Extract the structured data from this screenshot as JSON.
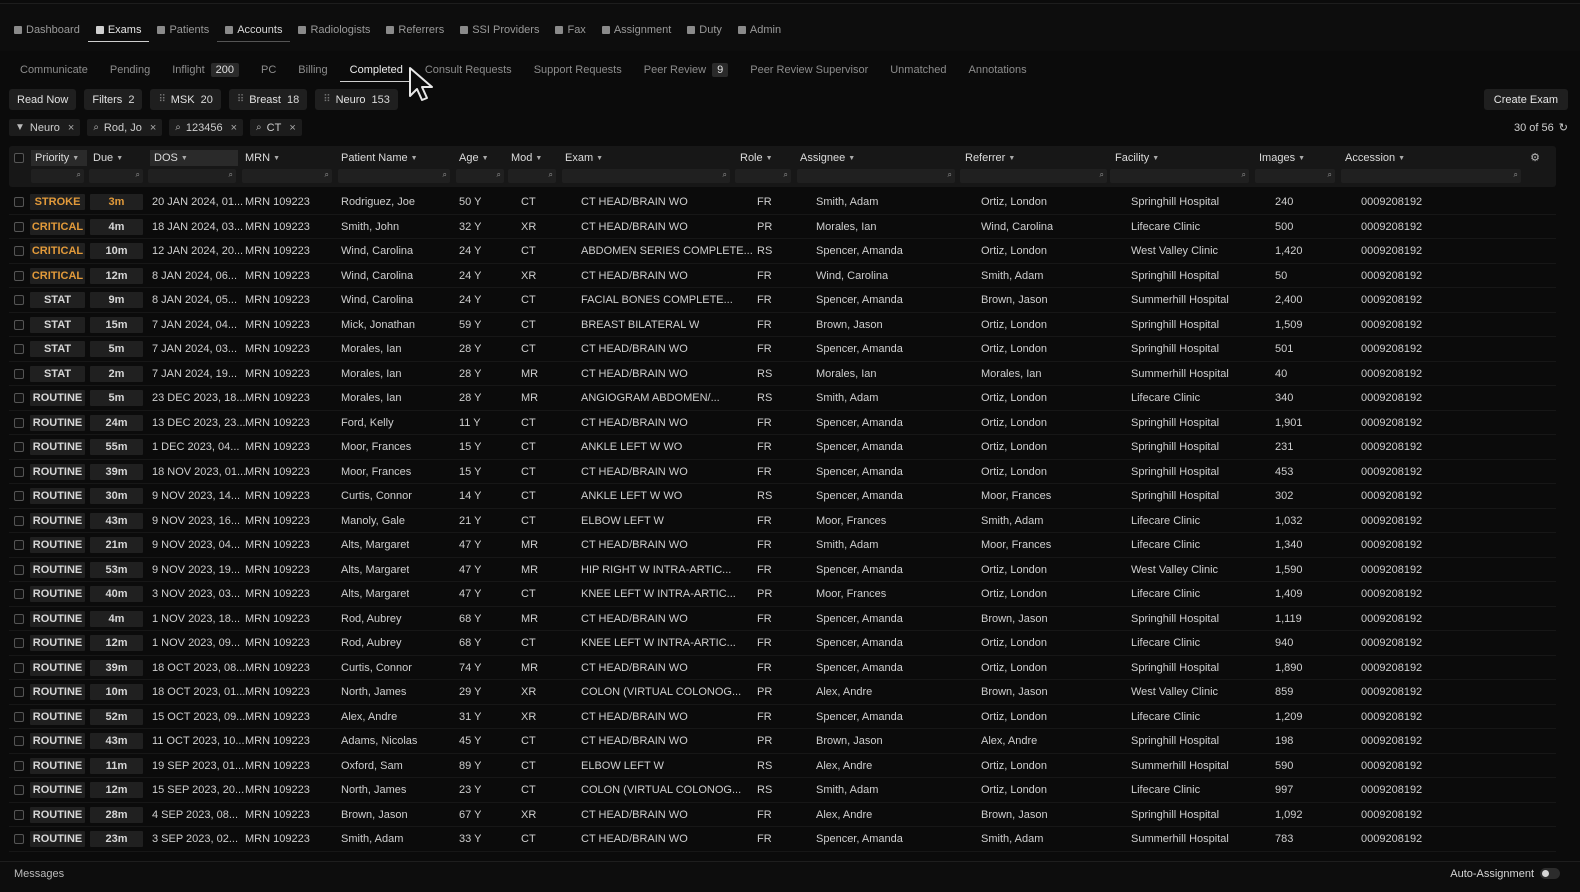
{
  "topnav": [
    {
      "label": "Dashboard",
      "icon": "grid-icon",
      "state": ""
    },
    {
      "label": "Exams",
      "icon": "doc-icon",
      "state": "active"
    },
    {
      "label": "Patients",
      "icon": "people-icon",
      "state": ""
    },
    {
      "label": "Accounts",
      "icon": "building-icon",
      "state": "hl"
    },
    {
      "label": "Radiologists",
      "icon": "person-icon",
      "state": ""
    },
    {
      "label": "Referrers",
      "icon": "card-icon",
      "state": ""
    },
    {
      "label": "SSI Providers",
      "icon": "people-icon",
      "state": ""
    },
    {
      "label": "Fax",
      "icon": "fax-icon",
      "state": ""
    },
    {
      "label": "Assignment",
      "icon": "check-icon",
      "state": ""
    },
    {
      "label": "Duty",
      "icon": "briefcase-icon",
      "state": ""
    },
    {
      "label": "Admin",
      "icon": "shield-icon",
      "state": ""
    }
  ],
  "subnav": [
    {
      "label": "Communicate",
      "count": ""
    },
    {
      "label": "Pending",
      "count": ""
    },
    {
      "label": "Inflight",
      "count": "200"
    },
    {
      "label": "PC",
      "count": ""
    },
    {
      "label": "Billing",
      "count": ""
    },
    {
      "label": "Completed",
      "count": "",
      "active": true
    },
    {
      "label": "Consult Requests",
      "count": ""
    },
    {
      "label": "Support Requests",
      "count": ""
    },
    {
      "label": "Peer Review",
      "count": "9"
    },
    {
      "label": "Peer Review Supervisor",
      "count": ""
    },
    {
      "label": "Unmatched",
      "count": ""
    },
    {
      "label": "Annotations",
      "count": ""
    }
  ],
  "toolbar": {
    "read_now": "Read Now",
    "filters_label": "Filters",
    "filters_count": "2",
    "groups": [
      {
        "label": "MSK",
        "count": "20"
      },
      {
        "label": "Breast",
        "count": "18"
      },
      {
        "label": "Neuro",
        "count": "153"
      }
    ],
    "create_exam": "Create Exam"
  },
  "active_filters": [
    {
      "label": "Neuro",
      "icon": "filter-icon"
    },
    {
      "label": "Rod, Jo",
      "icon": "search-icon"
    },
    {
      "label": "123456",
      "icon": "search-icon"
    },
    {
      "label": "CT",
      "icon": "search-icon"
    }
  ],
  "result_count": "30 of 56",
  "columns": [
    "Priority",
    "Due",
    "DOS",
    "MRN",
    "Patient Name",
    "Age",
    "Mod",
    "Exam",
    "Role",
    "Assignee",
    "Referrer",
    "Facility",
    "Images",
    "Accession"
  ],
  "rows": [
    [
      "STROKE",
      "3m",
      "20 JAN 2024, 01...",
      "MRN 109223",
      "Rodriguez, Joe",
      "50 Y",
      "CT",
      "CT HEAD/BRAIN WO",
      "FR",
      "Smith, Adam",
      "Ortiz, London",
      "Springhill Hospital",
      "240",
      "0009208192"
    ],
    [
      "CRITICAL",
      "4m",
      "18 JAN 2024, 03...",
      "MRN 109223",
      "Smith, John",
      "32 Y",
      "XR",
      "CT HEAD/BRAIN WO",
      "PR",
      "Morales, Ian",
      "Wind, Carolina",
      "Lifecare Clinic",
      "500",
      "0009208192"
    ],
    [
      "CRITICAL",
      "10m",
      "12 JAN 2024, 20...",
      "MRN 109223",
      "Wind, Carolina",
      "24 Y",
      "CT",
      "ABDOMEN SERIES COMPLETE...",
      "RS",
      "Spencer, Amanda",
      "Ortiz, London",
      "West Valley Clinic",
      "1,420",
      "0009208192"
    ],
    [
      "CRITICAL",
      "12m",
      "8 JAN 2024, 06...",
      "MRN 109223",
      "Wind, Carolina",
      "24 Y",
      "XR",
      "CT HEAD/BRAIN WO",
      "FR",
      "Wind, Carolina",
      "Smith, Adam",
      "Springhill Hospital",
      "50",
      "0009208192"
    ],
    [
      "STAT",
      "9m",
      "8 JAN 2024, 05...",
      "MRN 109223",
      "Wind, Carolina",
      "24 Y",
      "CT",
      "FACIAL BONES COMPLETE...",
      "FR",
      "Spencer, Amanda",
      "Brown, Jason",
      "Summerhill Hospital",
      "2,400",
      "0009208192"
    ],
    [
      "STAT",
      "15m",
      "7 JAN 2024, 04...",
      "MRN 109223",
      "Mick, Jonathan",
      "59 Y",
      "CT",
      "BREAST BILATERAL W",
      "FR",
      "Brown, Jason",
      "Ortiz, London",
      "Springhill Hospital",
      "1,509",
      "0009208192"
    ],
    [
      "STAT",
      "5m",
      "7 JAN 2024, 03...",
      "MRN 109223",
      "Morales, Ian",
      "28 Y",
      "CT",
      "CT HEAD/BRAIN WO",
      "FR",
      "Spencer, Amanda",
      "Ortiz, London",
      "Springhill Hospital",
      "501",
      "0009208192"
    ],
    [
      "STAT",
      "2m",
      "7 JAN 2024, 19...",
      "MRN 109223",
      "Morales, Ian",
      "28 Y",
      "MR",
      "CT HEAD/BRAIN WO",
      "RS",
      "Morales, Ian",
      "Morales, Ian",
      "Summerhill Hospital",
      "40",
      "0009208192"
    ],
    [
      "ROUTINE",
      "5m",
      "23 DEC 2023, 18...",
      "MRN 109223",
      "Morales, Ian",
      "28 Y",
      "MR",
      "ANGIOGRAM ABDOMEN/...",
      "RS",
      "Smith, Adam",
      "Ortiz, London",
      "Lifecare Clinic",
      "340",
      "0009208192"
    ],
    [
      "ROUTINE",
      "24m",
      "13 DEC 2023, 23...",
      "MRN 109223",
      "Ford, Kelly",
      "11 Y",
      "CT",
      "CT HEAD/BRAIN WO",
      "FR",
      "Spencer, Amanda",
      "Ortiz, London",
      "Springhill Hospital",
      "1,901",
      "0009208192"
    ],
    [
      "ROUTINE",
      "55m",
      "1 DEC 2023, 04...",
      "MRN 109223",
      "Moor, Frances",
      "15 Y",
      "CT",
      "ANKLE LEFT W WO",
      "FR",
      "Spencer, Amanda",
      "Ortiz, London",
      "Springhill Hospital",
      "231",
      "0009208192"
    ],
    [
      "ROUTINE",
      "39m",
      "18 NOV 2023, 01...",
      "MRN 109223",
      "Moor, Frances",
      "15 Y",
      "CT",
      "CT HEAD/BRAIN WO",
      "FR",
      "Spencer, Amanda",
      "Ortiz, London",
      "Springhill Hospital",
      "453",
      "0009208192"
    ],
    [
      "ROUTINE",
      "30m",
      "9 NOV 2023, 14...",
      "MRN 109223",
      "Curtis, Connor",
      "14 Y",
      "CT",
      "ANKLE LEFT W WO",
      "RS",
      "Spencer, Amanda",
      "Moor, Frances",
      "Springhill Hospital",
      "302",
      "0009208192"
    ],
    [
      "ROUTINE",
      "43m",
      "9 NOV 2023, 16...",
      "MRN 109223",
      "Manoly, Gale",
      "21 Y",
      "CT",
      "ELBOW LEFT W",
      "FR",
      "Moor, Frances",
      "Smith, Adam",
      "Lifecare Clinic",
      "1,032",
      "0009208192"
    ],
    [
      "ROUTINE",
      "21m",
      "9 NOV 2023, 04...",
      "MRN 109223",
      "Alts, Margaret",
      "47 Y",
      "MR",
      "CT HEAD/BRAIN WO",
      "FR",
      "Smith, Adam",
      "Moor, Frances",
      "Lifecare Clinic",
      "1,340",
      "0009208192"
    ],
    [
      "ROUTINE",
      "53m",
      "9 NOV 2023, 19...",
      "MRN 109223",
      "Alts, Margaret",
      "47 Y",
      "MR",
      "HIP RIGHT W INTRA-ARTIC...",
      "FR",
      "Spencer, Amanda",
      "Ortiz, London",
      "West Valley Clinic",
      "1,590",
      "0009208192"
    ],
    [
      "ROUTINE",
      "40m",
      "3 NOV 2023, 03...",
      "MRN 109223",
      "Alts, Margaret",
      "47 Y",
      "CT",
      "KNEE LEFT W INTRA-ARTIC...",
      "PR",
      "Moor, Frances",
      "Ortiz, London",
      "Lifecare Clinic",
      "1,409",
      "0009208192"
    ],
    [
      "ROUTINE",
      "4m",
      "1 NOV 2023, 18...",
      "MRN 109223",
      "Rod, Aubrey",
      "68 Y",
      "MR",
      "CT HEAD/BRAIN WO",
      "FR",
      "Spencer, Amanda",
      "Brown, Jason",
      "Springhill Hospital",
      "1,119",
      "0009208192"
    ],
    [
      "ROUTINE",
      "12m",
      "1 NOV 2023, 09...",
      "MRN 109223",
      "Rod, Aubrey",
      "68 Y",
      "CT",
      "KNEE LEFT W INTRA-ARTIC...",
      "FR",
      "Spencer, Amanda",
      "Ortiz, London",
      "Lifecare Clinic",
      "940",
      "0009208192"
    ],
    [
      "ROUTINE",
      "39m",
      "18 OCT 2023, 08...",
      "MRN 109223",
      "Curtis, Connor",
      "74 Y",
      "MR",
      "CT HEAD/BRAIN WO",
      "FR",
      "Spencer, Amanda",
      "Ortiz, London",
      "Springhill Hospital",
      "1,890",
      "0009208192"
    ],
    [
      "ROUTINE",
      "10m",
      "18 OCT 2023, 01...",
      "MRN 109223",
      "North, James",
      "29 Y",
      "XR",
      "COLON (VIRTUAL COLONOG...",
      "PR",
      "Alex, Andre",
      "Brown, Jason",
      "West Valley Clinic",
      "859",
      "0009208192"
    ],
    [
      "ROUTINE",
      "52m",
      "15 OCT 2023, 09...",
      "MRN 109223",
      "Alex, Andre",
      "31 Y",
      "XR",
      "CT HEAD/BRAIN WO",
      "FR",
      "Spencer, Amanda",
      "Ortiz, London",
      "Lifecare Clinic",
      "1,209",
      "0009208192"
    ],
    [
      "ROUTINE",
      "43m",
      "11 OCT 2023, 10...",
      "MRN 109223",
      "Adams, Nicolas",
      "45 Y",
      "CT",
      "CT HEAD/BRAIN WO",
      "PR",
      "Brown, Jason",
      "Alex, Andre",
      "Springhill Hospital",
      "198",
      "0009208192"
    ],
    [
      "ROUTINE",
      "11m",
      "19 SEP 2023, 01...",
      "MRN 109223",
      "Oxford, Sam",
      "89 Y",
      "CT",
      "ELBOW LEFT W",
      "RS",
      "Alex, Andre",
      "Ortiz, London",
      "Summerhill Hospital",
      "590",
      "0009208192"
    ],
    [
      "ROUTINE",
      "12m",
      "15 SEP 2023, 20...",
      "MRN 109223",
      "North, James",
      "23 Y",
      "CT",
      "COLON (VIRTUAL COLONOG...",
      "RS",
      "Smith, Adam",
      "Ortiz, London",
      "Lifecare Clinic",
      "997",
      "0009208192"
    ],
    [
      "ROUTINE",
      "28m",
      "4 SEP 2023, 08...",
      "MRN 109223",
      "Brown, Jason",
      "67 Y",
      "XR",
      "CT HEAD/BRAIN WO",
      "FR",
      "Alex, Andre",
      "Brown, Jason",
      "Springhill Hospital",
      "1,092",
      "0009208192"
    ],
    [
      "ROUTINE",
      "23m",
      "3 SEP 2023, 02...",
      "MRN 109223",
      "Smith, Adam",
      "33 Y",
      "CT",
      "CT HEAD/BRAIN WO",
      "FR",
      "Spencer, Amanda",
      "Smith, Adam",
      "Summerhill Hospital",
      "783",
      "0009208192"
    ]
  ],
  "statusbar": {
    "messages": "Messages",
    "auto_assignment": "Auto-Assignment"
  }
}
